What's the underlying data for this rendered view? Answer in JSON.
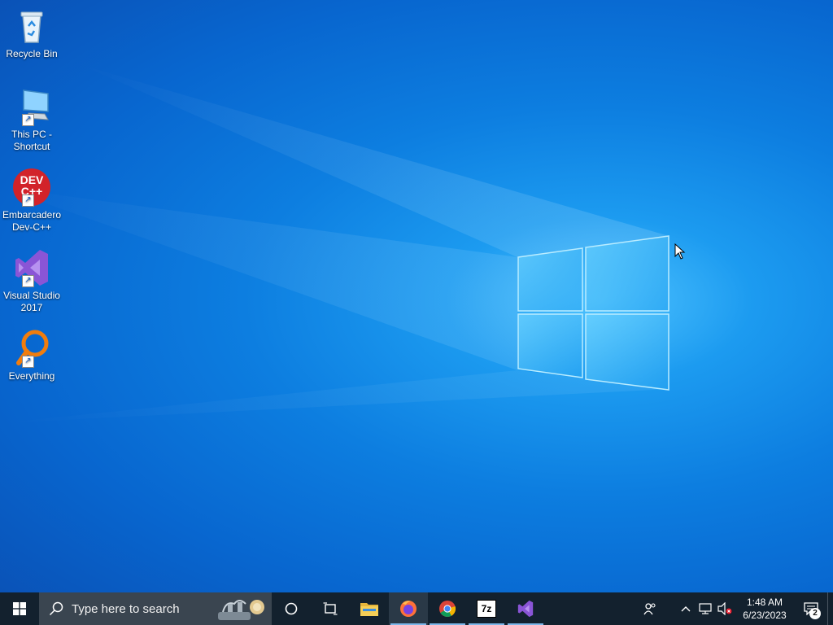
{
  "desktop": {
    "icons": [
      {
        "label": "Recycle Bin",
        "icon": "recycle-bin-icon"
      },
      {
        "label": "This PC -\nShortcut",
        "icon": "this-pc-icon"
      },
      {
        "label": "Embarcadero\nDev-C++",
        "icon": "devcpp-icon"
      },
      {
        "label": "Visual Studio\n2017",
        "icon": "visual-studio-icon"
      },
      {
        "label": "Everything",
        "icon": "everything-icon"
      }
    ],
    "devcpp_logo_text": "DEV C++"
  },
  "taskbar": {
    "search_placeholder": "Type here to search",
    "apps": [
      {
        "name": "File Explorer",
        "icon": "file-explorer-icon"
      },
      {
        "name": "Firefox",
        "icon": "firefox-icon"
      },
      {
        "name": "Google Chrome",
        "icon": "chrome-icon"
      },
      {
        "name": "7-Zip",
        "icon": "7zip-icon",
        "glyph": "7z"
      },
      {
        "name": "Visual Studio",
        "icon": "visual-studio-icon"
      }
    ],
    "clock": {
      "time": "1:48 AM",
      "date": "6/23/2023"
    },
    "notification_count": "2"
  },
  "colors": {
    "taskbar": "#13212e",
    "search_box": "#3a4550",
    "accent": "#0d7ee0"
  }
}
